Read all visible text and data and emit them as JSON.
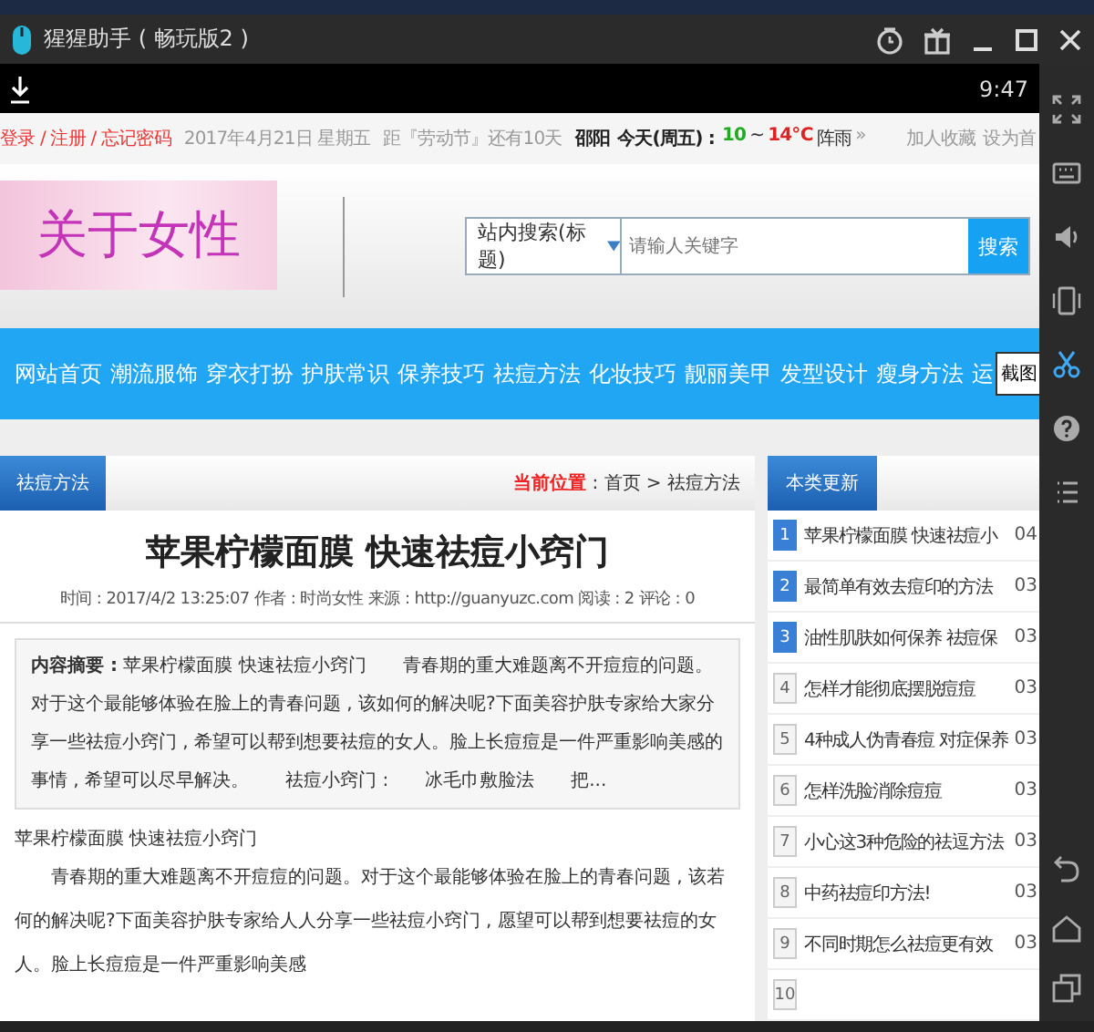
{
  "window": {
    "title": "猩猩助手 ( 畅玩版2 )"
  },
  "status_bar": {
    "time": "9:47"
  },
  "topbar": {
    "account_links": [
      "登录",
      "注册",
      "忘记密码"
    ],
    "separator": "/",
    "date": "2017年4月21日 星期五",
    "countdown": "距『劳动节』还有10天",
    "weather": {
      "city": "邵阳",
      "day": "今天(周五) :",
      "low": "10",
      "sep": "~",
      "high": "14℃",
      "condition": "阵雨",
      "more": "»"
    },
    "right_links": [
      "加人收藏",
      "设为首"
    ]
  },
  "logo": {
    "text": "关于女性"
  },
  "search": {
    "scope": "站内搜索(标题)",
    "placeholder": "请输人关键字",
    "button": "搜索"
  },
  "nav": {
    "items": [
      "网站首页",
      "潮流服饰",
      "穿衣打扮",
      "护肤常识",
      "保养技巧",
      "祛痘方法",
      "化妆技巧",
      "靓丽美甲",
      "发型设计",
      "瘦身方法",
      "运"
    ],
    "tooltip": "截图"
  },
  "article": {
    "tab": "祛痘方法",
    "breadcrumb_label": "当前位置",
    "breadcrumb_path": ": 首页 > 祛痘方法",
    "title": "苹果柠檬面膜 快速祛痘小窍门",
    "meta": "时间 : 2017/4/2 13:25:07  作者 : 时尚女性  来源 : http://guanyuzc.com  阅读 : 2  评论 : 0",
    "summary": "**内容摘要 :** 苹果柠檬面膜 快速祛痘小窍门　　青春期的重大难题离不开痘痘的问题。对于这个最能够体验在脸上的青春问题 , 该如何的解决呢?下面美容护肤专家给大家分享一些祛痘小窍门 , 希望可以帮到想要祛痘的女人。脸上长痘痘是一件严重影响美感的事情 , 希望可以尽早解决。　　祛痘小窍门 :　　冰毛巾敷脸法　　把...",
    "subtitle": "苹果柠檬面膜 快速祛痘小窍门",
    "body": "　　青春期的重大难题离不开痘痘的问题。对于这个最能够体验在脸上的青春问题 , 该若何的解决呢?下面美容护肤专家给人人分享一些祛痘小窍门 , 愿望可以帮到想要祛痘的女人。脸上长痘痘是一件严重影响美感"
  },
  "sidebar": {
    "title": "本类更新",
    "items": [
      {
        "num": "1",
        "top": true,
        "title": "苹果柠檬面膜 快速祛痘小",
        "date": "04"
      },
      {
        "num": "2",
        "top": true,
        "title": "最简单有效去痘印的方法",
        "date": "03"
      },
      {
        "num": "3",
        "top": true,
        "title": "油性肌肤如何保养 祛痘保",
        "date": "03"
      },
      {
        "num": "4",
        "top": false,
        "title": "怎样才能彻底摆脱痘痘",
        "date": "03"
      },
      {
        "num": "5",
        "top": false,
        "title": "4种成人伪青春痘 对症保养",
        "date": "03"
      },
      {
        "num": "6",
        "top": false,
        "title": "怎样洗脸消除痘痘",
        "date": "03"
      },
      {
        "num": "7",
        "top": false,
        "title": "小心这3种危险的祛逗方法",
        "date": "03"
      },
      {
        "num": "8",
        "top": false,
        "title": "中药祛痘印方法!",
        "date": "03"
      },
      {
        "num": "9",
        "top": false,
        "title": "不同时期怎么祛痘更有效",
        "date": "03"
      },
      {
        "num": "10",
        "top": false
      }
    ]
  }
}
